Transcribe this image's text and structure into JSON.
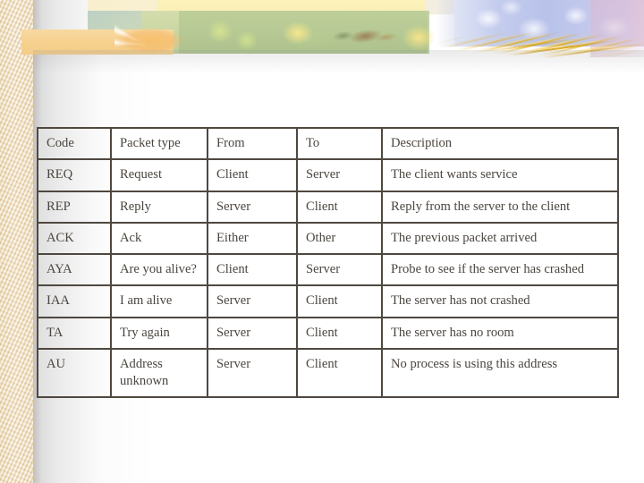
{
  "slide": {
    "background_color": "#ffffff",
    "left_band_color": "#ecd9b4",
    "text_color": "#4b453f",
    "border_color": "#4f4840",
    "decoration": {
      "name": "floral-header-banner",
      "elements": [
        "white-leaf",
        "orange-flower",
        "green-foliage",
        "bird",
        "blue-hydrangea",
        "golden-wheat"
      ]
    }
  },
  "table": {
    "name": "packet-types-table",
    "headers": [
      "Code",
      "Packet type",
      "From",
      "To",
      "Description"
    ],
    "rows": [
      {
        "code": "REQ",
        "packet_type": "Request",
        "from": "Client",
        "to": "Server",
        "description": "The client wants service"
      },
      {
        "code": "REP",
        "packet_type": "Reply",
        "from": "Server",
        "to": "Client",
        "description": "Reply from the server to the client"
      },
      {
        "code": "ACK",
        "packet_type": "Ack",
        "from": "Either",
        "to": "Other",
        "description": "The previous packet arrived"
      },
      {
        "code": "AYA",
        "packet_type": "Are you alive?",
        "from": "Client",
        "to": "Server",
        "description": "Probe to see if the server has crashed"
      },
      {
        "code": "IAA",
        "packet_type": "I am alive",
        "from": "Server",
        "to": "Client",
        "description": "The server has not crashed"
      },
      {
        "code": "TA",
        "packet_type": "Try again",
        "from": "Server",
        "to": "Client",
        "description": "The server has no room"
      },
      {
        "code": "AU",
        "packet_type": "Address unknown",
        "from": "Server",
        "to": "Client",
        "description": "No process is using this address"
      }
    ]
  }
}
